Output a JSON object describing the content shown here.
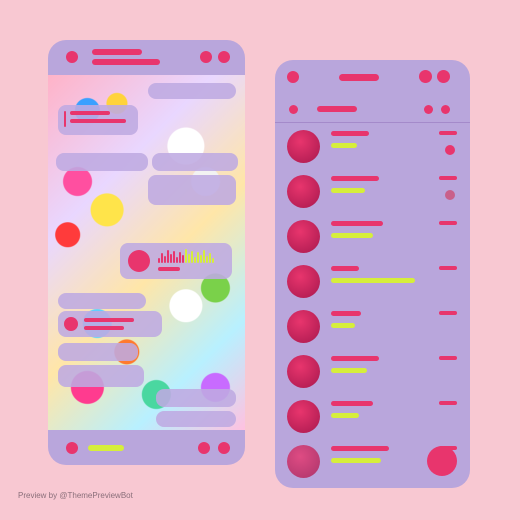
{
  "colors": {
    "background": "#f8c8d2",
    "phone": "#b9a6dc",
    "accent": "#e8356d",
    "lime": "#d6ee3b"
  },
  "watermark": {
    "prefix": "Preview by ",
    "handle": "@ThemePreviewBot"
  },
  "left_phone": {
    "header_icons": [
      "back-icon",
      "avatar-icon",
      "menu-icon"
    ],
    "footer_icons": [
      "attach-icon",
      "emoji-icon",
      "send-icon"
    ]
  },
  "right_phone": {
    "header_icons": [
      "menu-icon",
      "search-icon",
      "more-icon"
    ],
    "subheader_icons": [
      "filter-icon",
      "folder-icon",
      "settings-icon"
    ],
    "chats": [
      {
        "name_w": 38,
        "msg_w": 26,
        "time_w": 18
      },
      {
        "name_w": 48,
        "msg_w": 34,
        "time_w": 18
      },
      {
        "name_w": 52,
        "msg_w": 42,
        "time_w": 18
      },
      {
        "name_w": 28,
        "msg_w": 84,
        "time_w": 18
      },
      {
        "name_w": 30,
        "msg_w": 24,
        "time_w": 18
      },
      {
        "name_w": 48,
        "msg_w": 36,
        "time_w": 18
      },
      {
        "name_w": 42,
        "msg_w": 28,
        "time_w": 18
      },
      {
        "name_w": 58,
        "msg_w": 50,
        "time_w": 18
      }
    ],
    "fab_icon": "compose-icon"
  }
}
